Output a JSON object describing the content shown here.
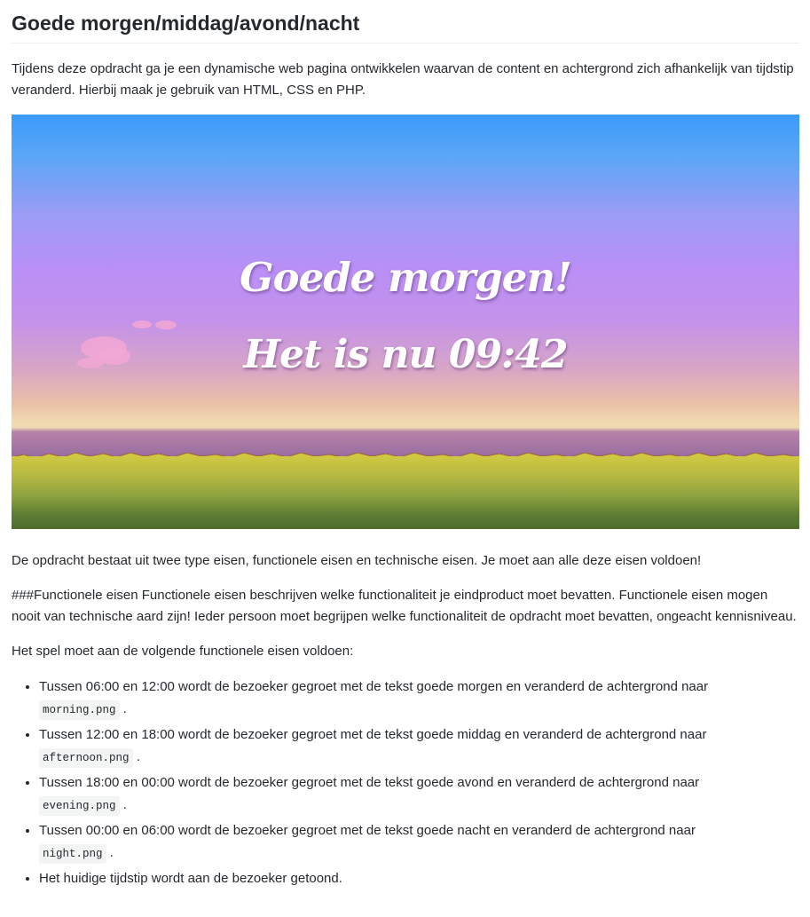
{
  "page": {
    "title": "Goede morgen/middag/avond/nacht",
    "intro": "Tijdens deze opdracht ga je een dynamische web pagina ontwikkelen waarvan de content en achtergrond zich afhankelijk van tijdstip veranderd. Hierbij maak je gebruik van HTML, CSS en PHP."
  },
  "hero": {
    "greeting": "Goede morgen!",
    "time_text": "Het is nu 09:42",
    "colors": {
      "sky_top": "#3c9af9",
      "sky_mid": "#b98ff7",
      "horizon": "#f1d9b0",
      "water": "#9b6fa1",
      "grass": "#cfc842",
      "ground_dark": "#4e6d2c",
      "cloud": "#f2a7d5"
    }
  },
  "body": {
    "para1": "De opdracht bestaat uit twee type eisen, functionele eisen en technische eisen. Je moet aan alle deze eisen voldoen!",
    "para2": "###Functionele eisen Functionele eisen beschrijven welke functionaliteit je eindproduct moet bevatten. Functionele eisen mogen nooit van technische aard zijn! Ieder persoon moet begrijpen welke functionaliteit de opdracht moet bevatten, ongeacht kennisniveau.",
    "para3": "Het spel moet aan de volgende functionele eisen voldoen:"
  },
  "requirements": [
    {
      "text": "Tussen 06:00 en 12:00 wordt de bezoeker gegroet met de tekst goede morgen en veranderd de achtergrond naar",
      "code": "morning.png",
      "end": "."
    },
    {
      "text": "Tussen 12:00 en 18:00 wordt de bezoeker gegroet met de tekst goede middag en veranderd de achtergrond naar",
      "code": "afternoon.png",
      "end": "."
    },
    {
      "text": "Tussen 18:00 en 00:00 wordt de bezoeker gegroet met de tekst goede avond en veranderd de achtergrond naar",
      "code": "evening.png",
      "end": "."
    },
    {
      "text": "Tussen 00:00 en 06:00 wordt de bezoeker gegroet met de tekst goede nacht en veranderd de achtergrond naar",
      "code": "night.png",
      "end": "."
    },
    {
      "text": "Het huidige tijdstip wordt aan de bezoeker getoond."
    }
  ]
}
